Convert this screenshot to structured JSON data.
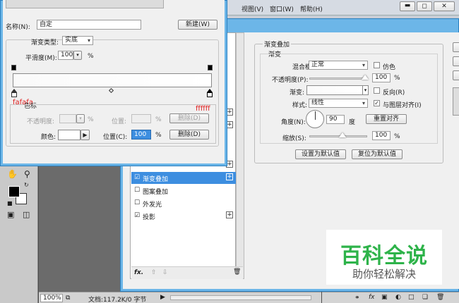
{
  "menu": {
    "view": "视图(V)",
    "window": "窗口(W)",
    "help": "帮助(H)"
  },
  "gradient_editor": {
    "name_label": "名称(N):",
    "name_value": "自定",
    "new_button": "新建(W)",
    "gradient_type_label": "渐变类型:",
    "gradient_type_value": "实底",
    "smoothness_label": "平滑度(M):",
    "smoothness_value": "100",
    "percent": "%",
    "start_hex": "fafafa",
    "end_hex": "ffffff",
    "stops_label": "色标",
    "opacity_label": "不透明度:",
    "position_label": "位置:",
    "delete_button": "删除(D)",
    "color_label": "颜色:",
    "position_c_label": "位置(C):",
    "position_c_value": "100",
    "delete_button_active": "删除(D)"
  },
  "layer_style": {
    "header": "渐变叠加",
    "sub": "渐变",
    "blend_mode_label": "混合模式:",
    "blend_mode_value": "正常",
    "dither_label": "仿色",
    "opacity_label": "不透明度(P):",
    "opacity_value": "100",
    "percent": "%",
    "gradient_label": "渐变:",
    "reverse_label": "反向(R)",
    "style_label": "样式:",
    "style_value": "线性",
    "align_label": "与图层对齐(I)",
    "angle_label": "角度(N):",
    "angle_value": "90",
    "degree": "度",
    "reset_align_button": "重置对齐",
    "scale_label": "缩放(S):",
    "scale_value": "100",
    "set_default_button": "设置为默认值",
    "reset_default_button": "复位为默认值",
    "effects": [
      {
        "label": "渐变叠加",
        "checked": true,
        "selected": true,
        "plus": true
      },
      {
        "label": "图案叠加",
        "checked": false,
        "selected": false,
        "plus": false
      },
      {
        "label": "外发光",
        "checked": false,
        "selected": false,
        "plus": false
      },
      {
        "label": "投影",
        "checked": true,
        "selected": false,
        "plus": true
      }
    ]
  },
  "status_bar": {
    "zoom": "100%",
    "doc_info": "文档:117.2K/0 字节"
  },
  "watermark": {
    "title": "百科全说",
    "subtitle": "助你轻松解决"
  },
  "colors": {
    "title_blue": "#2f9fd9",
    "selected_blue": "#3d8ee0",
    "panel_gray": "#e8e8e8",
    "hex_red": "#e02020",
    "watermark_green": "#2eb34a"
  }
}
